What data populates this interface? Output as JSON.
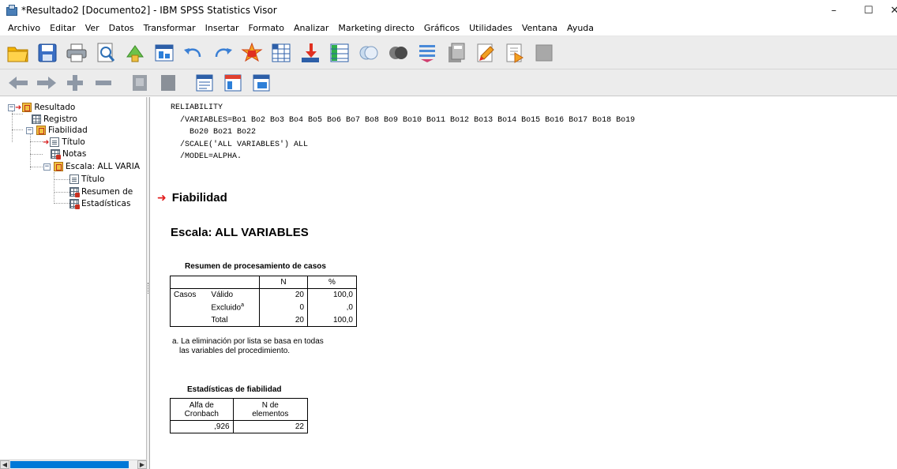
{
  "window": {
    "title": "*Resultado2 [Documento2] - IBM SPSS Statistics Visor",
    "minimize": "–",
    "maximize": "☐",
    "close": "✕"
  },
  "menu": [
    {
      "label": "Archivo"
    },
    {
      "label": "Editar"
    },
    {
      "label": "Ver"
    },
    {
      "label": "Datos"
    },
    {
      "label": "Transformar"
    },
    {
      "label": "Insertar"
    },
    {
      "label": "Formato"
    },
    {
      "label": "Analizar"
    },
    {
      "label": "Marketing directo"
    },
    {
      "label": "Gráficos"
    },
    {
      "label": "Utilidades"
    },
    {
      "label": "Ventana"
    },
    {
      "label": "Ayuda"
    }
  ],
  "navigator": {
    "items": [
      {
        "label": "Resultado"
      },
      {
        "label": "Registro"
      },
      {
        "label": "Fiabilidad"
      },
      {
        "label": "Título"
      },
      {
        "label": "Notas"
      },
      {
        "label": "Escala: ALL VARIA"
      },
      {
        "label": "Título"
      },
      {
        "label": "Resumen de"
      },
      {
        "label": "Estadísticas"
      }
    ]
  },
  "output": {
    "syntax_lines": [
      "RELIABILITY",
      "  /VARIABLES=Bo1 Bo2 Bo3 Bo4 Bo5 Bo6 Bo7 Bo8 Bo9 Bo10 Bo11 Bo12 Bo13 Bo14 Bo15 Bo16 Bo17 Bo18 Bo19",
      "    Bo20 Bo21 Bo22",
      "  /SCALE('ALL VARIABLES') ALL",
      "  /MODEL=ALPHA."
    ],
    "heading": "Fiabilidad",
    "subheading": "Escala: ALL VARIABLES",
    "summary_table": {
      "title": "Resumen de procesamiento de casos",
      "col_n": "N",
      "col_pct": "%",
      "row_group": "Casos",
      "rows": [
        {
          "label": "Válido",
          "n": "20",
          "pct": "100,0"
        },
        {
          "label": "Excluido",
          "sup": "a",
          "n": "0",
          "pct": ",0"
        },
        {
          "label": "Total",
          "n": "20",
          "pct": "100,0"
        }
      ],
      "footnote_line1": "a. La eliminación por lista se basa en todas",
      "footnote_line2": "las variables del procedimiento."
    },
    "reliability_table": {
      "title": "Estadísticas de fiabilidad",
      "col1_line1": "Alfa de",
      "col1_line2": "Cronbach",
      "col2_line1": "N de",
      "col2_line2": "elementos",
      "alpha": ",926",
      "n_items": "22"
    }
  }
}
